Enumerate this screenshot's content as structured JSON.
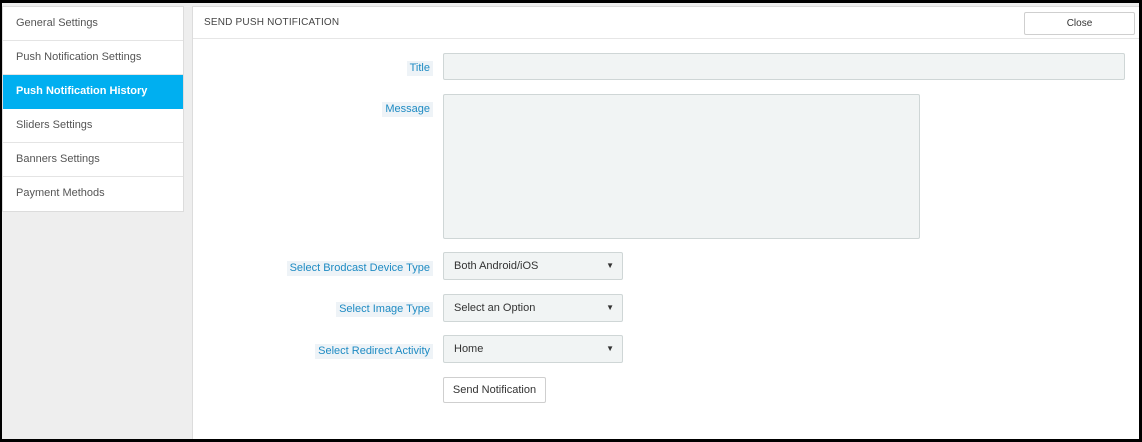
{
  "sidebar": {
    "items": [
      {
        "label": "General Settings"
      },
      {
        "label": "Push Notification Settings"
      },
      {
        "label": "Push Notification History"
      },
      {
        "label": "Sliders Settings"
      },
      {
        "label": "Banners Settings"
      },
      {
        "label": "Payment Methods"
      }
    ],
    "active_index": 2
  },
  "panel": {
    "title": "SEND PUSH NOTIFICATION",
    "close_label": "Close"
  },
  "form": {
    "title_label": "Title",
    "title_value": "",
    "message_label": "Message",
    "message_value": "",
    "device_type_label": "Select Brodcast Device Type",
    "device_type_value": "Both Android/iOS",
    "image_type_label": "Select Image Type",
    "image_type_value": "Select an Option",
    "redirect_label": "Select Redirect Activity",
    "redirect_value": "Home",
    "submit_label": "Send Notification"
  },
  "colors": {
    "accent": "#00aff0",
    "label_text": "#1e8bc3",
    "input_bg": "#f1f4f4",
    "page_bg": "#eeeeee"
  }
}
